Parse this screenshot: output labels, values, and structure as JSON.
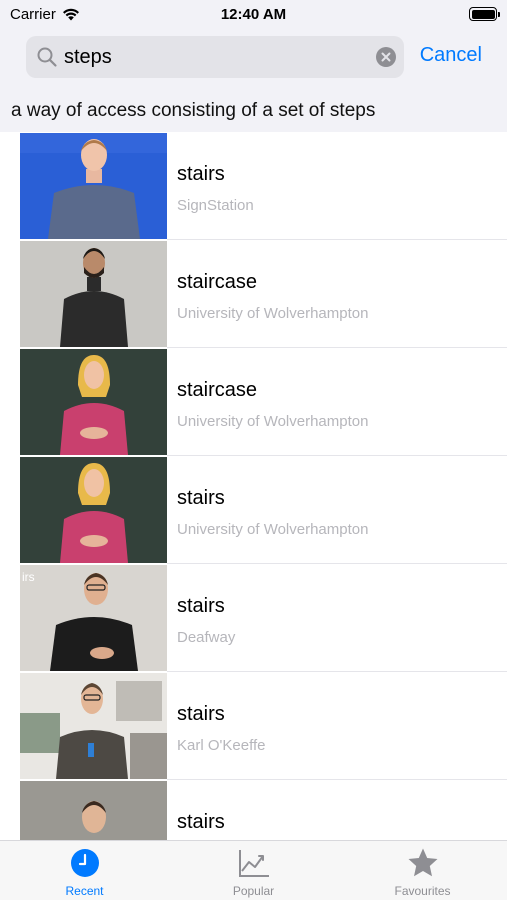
{
  "status_bar": {
    "carrier": "Carrier",
    "time": "12:40 AM"
  },
  "search": {
    "query": "steps",
    "cancel_label": "Cancel"
  },
  "definition": "a way of access consisting of a set of steps",
  "results": [
    {
      "title": "stairs",
      "source": "SignStation"
    },
    {
      "title": "staircase",
      "source": "University of Wolverhampton"
    },
    {
      "title": "staircase",
      "source": "University of Wolverhampton"
    },
    {
      "title": "stairs",
      "source": "University of Wolverhampton"
    },
    {
      "title": "stairs",
      "source": "Deafway",
      "thumb_caption": "irs"
    },
    {
      "title": "stairs",
      "source": "Karl O'Keeffe"
    },
    {
      "title": "stairs",
      "source": ""
    }
  ],
  "tabs": [
    {
      "label": "Recent",
      "icon": "clock-icon",
      "active": true
    },
    {
      "label": "Popular",
      "icon": "chart-icon",
      "active": false
    },
    {
      "label": "Favourites",
      "icon": "star-icon",
      "active": false
    }
  ],
  "colors": {
    "accent": "#007aff",
    "secondary_text": "#b6b6bb",
    "search_bg": "#e3e3e8"
  }
}
